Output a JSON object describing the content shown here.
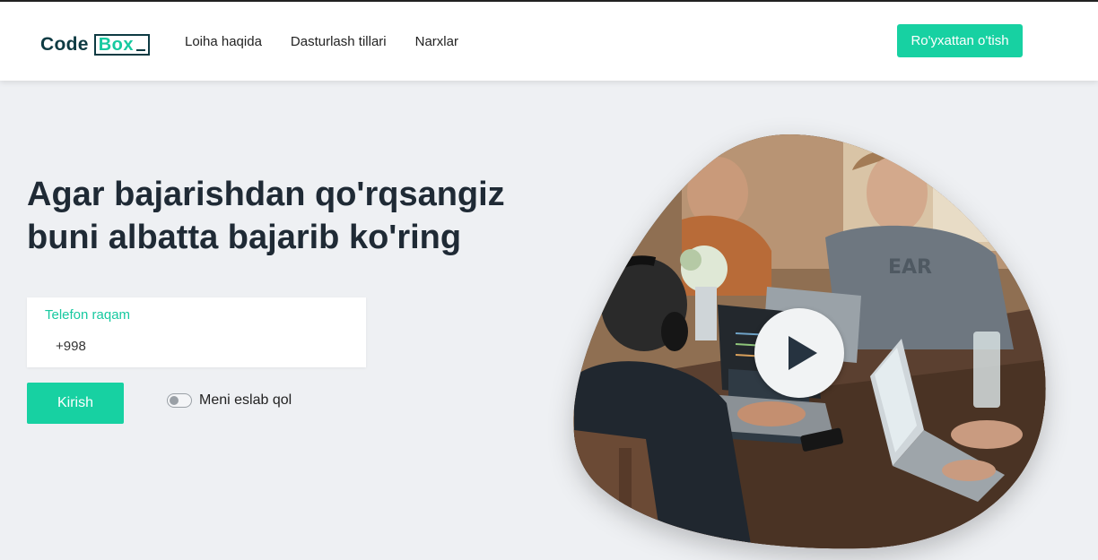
{
  "brand": {
    "code": "Code",
    "box": "Box"
  },
  "nav": {
    "links": [
      "Loiha haqida",
      "Dasturlash tillari",
      "Narxlar"
    ],
    "signup": "Ro'yxattan o'tish"
  },
  "hero": {
    "title_lines": [
      "Agar bajarishdan qo'rqsangiz",
      "buni albatta bajarib ko'ring"
    ]
  },
  "form": {
    "phone_label": "Telefon raqam",
    "phone_value": "+998",
    "submit": "Kirish",
    "remember_label": "Meni eslab qol",
    "remember_checked": false
  },
  "media": {
    "icon": "play-icon"
  },
  "colors": {
    "accent": "#17d1a2",
    "brand_dark": "#0e3b43",
    "background": "#eef0f3"
  }
}
